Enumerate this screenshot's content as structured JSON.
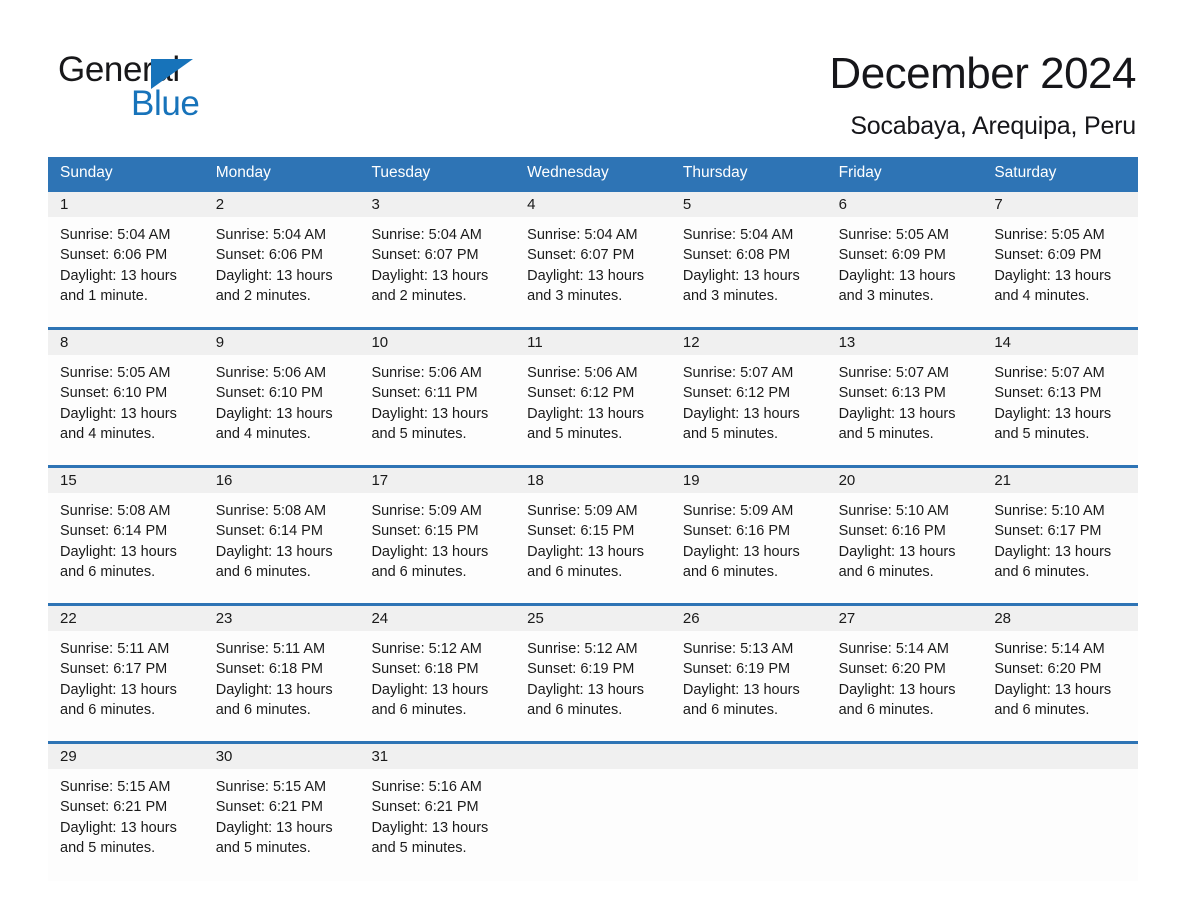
{
  "brand": {
    "word_one": "General",
    "word_two": "Blue",
    "triangle_color": "#1773ba",
    "text_color": "#18181a"
  },
  "header": {
    "month_title": "December 2024",
    "location": "Socabaya, Arequipa, Peru"
  },
  "theme": {
    "header_blue": "#2e74b5",
    "daynum_band": "#f0f0f0",
    "cell_background": "#fdfdfd",
    "text": "#1a1a1a"
  },
  "weekdays": [
    "Sunday",
    "Monday",
    "Tuesday",
    "Wednesday",
    "Thursday",
    "Friday",
    "Saturday"
  ],
  "weeks": [
    {
      "days": [
        {
          "date": "1",
          "sunrise": "Sunrise: 5:04 AM",
          "sunset": "Sunset: 6:06 PM",
          "daylight_line1": "Daylight: 13 hours",
          "daylight_line2": "and 1 minute."
        },
        {
          "date": "2",
          "sunrise": "Sunrise: 5:04 AM",
          "sunset": "Sunset: 6:06 PM",
          "daylight_line1": "Daylight: 13 hours",
          "daylight_line2": "and 2 minutes."
        },
        {
          "date": "3",
          "sunrise": "Sunrise: 5:04 AM",
          "sunset": "Sunset: 6:07 PM",
          "daylight_line1": "Daylight: 13 hours",
          "daylight_line2": "and 2 minutes."
        },
        {
          "date": "4",
          "sunrise": "Sunrise: 5:04 AM",
          "sunset": "Sunset: 6:07 PM",
          "daylight_line1": "Daylight: 13 hours",
          "daylight_line2": "and 3 minutes."
        },
        {
          "date": "5",
          "sunrise": "Sunrise: 5:04 AM",
          "sunset": "Sunset: 6:08 PM",
          "daylight_line1": "Daylight: 13 hours",
          "daylight_line2": "and 3 minutes."
        },
        {
          "date": "6",
          "sunrise": "Sunrise: 5:05 AM",
          "sunset": "Sunset: 6:09 PM",
          "daylight_line1": "Daylight: 13 hours",
          "daylight_line2": "and 3 minutes."
        },
        {
          "date": "7",
          "sunrise": "Sunrise: 5:05 AM",
          "sunset": "Sunset: 6:09 PM",
          "daylight_line1": "Daylight: 13 hours",
          "daylight_line2": "and 4 minutes."
        }
      ]
    },
    {
      "days": [
        {
          "date": "8",
          "sunrise": "Sunrise: 5:05 AM",
          "sunset": "Sunset: 6:10 PM",
          "daylight_line1": "Daylight: 13 hours",
          "daylight_line2": "and 4 minutes."
        },
        {
          "date": "9",
          "sunrise": "Sunrise: 5:06 AM",
          "sunset": "Sunset: 6:10 PM",
          "daylight_line1": "Daylight: 13 hours",
          "daylight_line2": "and 4 minutes."
        },
        {
          "date": "10",
          "sunrise": "Sunrise: 5:06 AM",
          "sunset": "Sunset: 6:11 PM",
          "daylight_line1": "Daylight: 13 hours",
          "daylight_line2": "and 5 minutes."
        },
        {
          "date": "11",
          "sunrise": "Sunrise: 5:06 AM",
          "sunset": "Sunset: 6:12 PM",
          "daylight_line1": "Daylight: 13 hours",
          "daylight_line2": "and 5 minutes."
        },
        {
          "date": "12",
          "sunrise": "Sunrise: 5:07 AM",
          "sunset": "Sunset: 6:12 PM",
          "daylight_line1": "Daylight: 13 hours",
          "daylight_line2": "and 5 minutes."
        },
        {
          "date": "13",
          "sunrise": "Sunrise: 5:07 AM",
          "sunset": "Sunset: 6:13 PM",
          "daylight_line1": "Daylight: 13 hours",
          "daylight_line2": "and 5 minutes."
        },
        {
          "date": "14",
          "sunrise": "Sunrise: 5:07 AM",
          "sunset": "Sunset: 6:13 PM",
          "daylight_line1": "Daylight: 13 hours",
          "daylight_line2": "and 5 minutes."
        }
      ]
    },
    {
      "days": [
        {
          "date": "15",
          "sunrise": "Sunrise: 5:08 AM",
          "sunset": "Sunset: 6:14 PM",
          "daylight_line1": "Daylight: 13 hours",
          "daylight_line2": "and 6 minutes."
        },
        {
          "date": "16",
          "sunrise": "Sunrise: 5:08 AM",
          "sunset": "Sunset: 6:14 PM",
          "daylight_line1": "Daylight: 13 hours",
          "daylight_line2": "and 6 minutes."
        },
        {
          "date": "17",
          "sunrise": "Sunrise: 5:09 AM",
          "sunset": "Sunset: 6:15 PM",
          "daylight_line1": "Daylight: 13 hours",
          "daylight_line2": "and 6 minutes."
        },
        {
          "date": "18",
          "sunrise": "Sunrise: 5:09 AM",
          "sunset": "Sunset: 6:15 PM",
          "daylight_line1": "Daylight: 13 hours",
          "daylight_line2": "and 6 minutes."
        },
        {
          "date": "19",
          "sunrise": "Sunrise: 5:09 AM",
          "sunset": "Sunset: 6:16 PM",
          "daylight_line1": "Daylight: 13 hours",
          "daylight_line2": "and 6 minutes."
        },
        {
          "date": "20",
          "sunrise": "Sunrise: 5:10 AM",
          "sunset": "Sunset: 6:16 PM",
          "daylight_line1": "Daylight: 13 hours",
          "daylight_line2": "and 6 minutes."
        },
        {
          "date": "21",
          "sunrise": "Sunrise: 5:10 AM",
          "sunset": "Sunset: 6:17 PM",
          "daylight_line1": "Daylight: 13 hours",
          "daylight_line2": "and 6 minutes."
        }
      ]
    },
    {
      "days": [
        {
          "date": "22",
          "sunrise": "Sunrise: 5:11 AM",
          "sunset": "Sunset: 6:17 PM",
          "daylight_line1": "Daylight: 13 hours",
          "daylight_line2": "and 6 minutes."
        },
        {
          "date": "23",
          "sunrise": "Sunrise: 5:11 AM",
          "sunset": "Sunset: 6:18 PM",
          "daylight_line1": "Daylight: 13 hours",
          "daylight_line2": "and 6 minutes."
        },
        {
          "date": "24",
          "sunrise": "Sunrise: 5:12 AM",
          "sunset": "Sunset: 6:18 PM",
          "daylight_line1": "Daylight: 13 hours",
          "daylight_line2": "and 6 minutes."
        },
        {
          "date": "25",
          "sunrise": "Sunrise: 5:12 AM",
          "sunset": "Sunset: 6:19 PM",
          "daylight_line1": "Daylight: 13 hours",
          "daylight_line2": "and 6 minutes."
        },
        {
          "date": "26",
          "sunrise": "Sunrise: 5:13 AM",
          "sunset": "Sunset: 6:19 PM",
          "daylight_line1": "Daylight: 13 hours",
          "daylight_line2": "and 6 minutes."
        },
        {
          "date": "27",
          "sunrise": "Sunrise: 5:14 AM",
          "sunset": "Sunset: 6:20 PM",
          "daylight_line1": "Daylight: 13 hours",
          "daylight_line2": "and 6 minutes."
        },
        {
          "date": "28",
          "sunrise": "Sunrise: 5:14 AM",
          "sunset": "Sunset: 6:20 PM",
          "daylight_line1": "Daylight: 13 hours",
          "daylight_line2": "and 6 minutes."
        }
      ]
    },
    {
      "days": [
        {
          "date": "29",
          "sunrise": "Sunrise: 5:15 AM",
          "sunset": "Sunset: 6:21 PM",
          "daylight_line1": "Daylight: 13 hours",
          "daylight_line2": "and 5 minutes."
        },
        {
          "date": "30",
          "sunrise": "Sunrise: 5:15 AM",
          "sunset": "Sunset: 6:21 PM",
          "daylight_line1": "Daylight: 13 hours",
          "daylight_line2": "and 5 minutes."
        },
        {
          "date": "31",
          "sunrise": "Sunrise: 5:16 AM",
          "sunset": "Sunset: 6:21 PM",
          "daylight_line1": "Daylight: 13 hours",
          "daylight_line2": "and 5 minutes."
        },
        {
          "date": "",
          "sunrise": "",
          "sunset": "",
          "daylight_line1": "",
          "daylight_line2": ""
        },
        {
          "date": "",
          "sunrise": "",
          "sunset": "",
          "daylight_line1": "",
          "daylight_line2": ""
        },
        {
          "date": "",
          "sunrise": "",
          "sunset": "",
          "daylight_line1": "",
          "daylight_line2": ""
        },
        {
          "date": "",
          "sunrise": "",
          "sunset": "",
          "daylight_line1": "",
          "daylight_line2": ""
        }
      ]
    }
  ]
}
